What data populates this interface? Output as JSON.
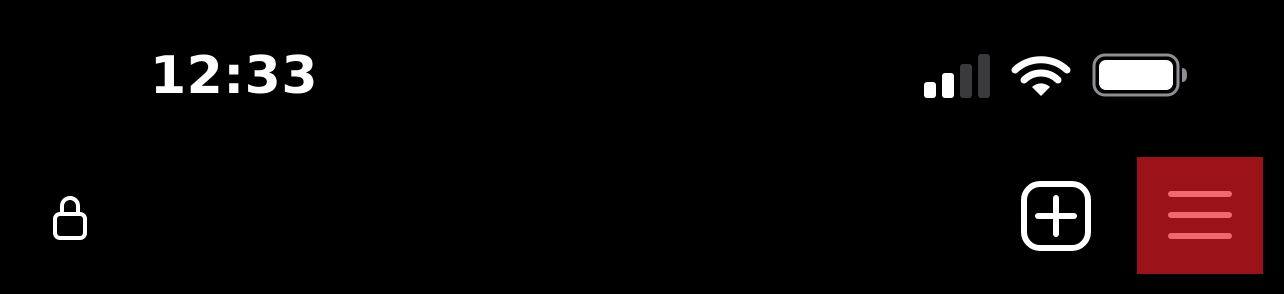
{
  "status_bar": {
    "time": "12:33",
    "signal_bars_active": 2,
    "signal_bars_total": 4,
    "wifi_icon": "wifi-icon",
    "battery_icon": "battery-full-icon",
    "battery_level": 1.0
  },
  "toolbar": {
    "lock_icon": "lock-icon",
    "add_icon": "plus-square-icon",
    "menu_icon": "hamburger-menu-icon"
  },
  "colors": {
    "background": "#000000",
    "foreground": "#ffffff",
    "signal_inactive": "#3a3a3c",
    "menu_background": "#9b1218",
    "menu_lines": "#f0696d"
  }
}
